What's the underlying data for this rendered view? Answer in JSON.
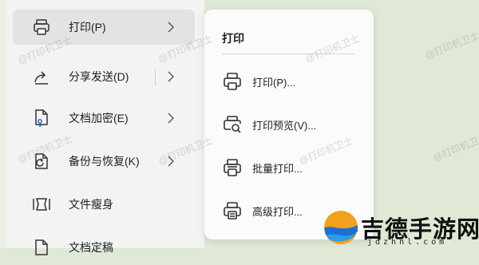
{
  "main_menu": {
    "items": [
      {
        "label": "打印(P)",
        "icon": "printer-icon",
        "has_submenu": true,
        "hover": true
      },
      {
        "label": "分享发送(D)",
        "icon": "share-icon",
        "has_submenu": true,
        "split": true
      },
      {
        "label": "文档加密(E)",
        "icon": "encrypt-document-icon",
        "has_submenu": true
      },
      {
        "label": "备份与恢复(K)",
        "icon": "backup-icon",
        "has_submenu": true
      },
      {
        "label": "文件瘦身",
        "icon": "file-slim-icon",
        "has_submenu": false
      },
      {
        "label": "文档定稿",
        "icon": "document-finalize-icon",
        "has_submenu": false
      }
    ]
  },
  "print_submenu": {
    "title": "打印",
    "items": [
      {
        "label": "打印(P)...",
        "icon": "printer-icon"
      },
      {
        "label": "打印预览(V)...",
        "icon": "print-preview-icon"
      },
      {
        "label": "批量打印...",
        "icon": "batch-print-icon"
      },
      {
        "label": "高级打印...",
        "icon": "advanced-print-icon"
      }
    ]
  },
  "watermark": {
    "text": "@打印机卫士"
  },
  "site_logo": {
    "name": "吉德手游网",
    "url": "jdzhnl.com"
  },
  "colors": {
    "background": "#dfe9d6",
    "menu_bg": "#f3f3f3",
    "hover_bg": "#e3e3e3",
    "accent_blue": "#1f6fd1",
    "logo_orange": "#f2a11a"
  }
}
